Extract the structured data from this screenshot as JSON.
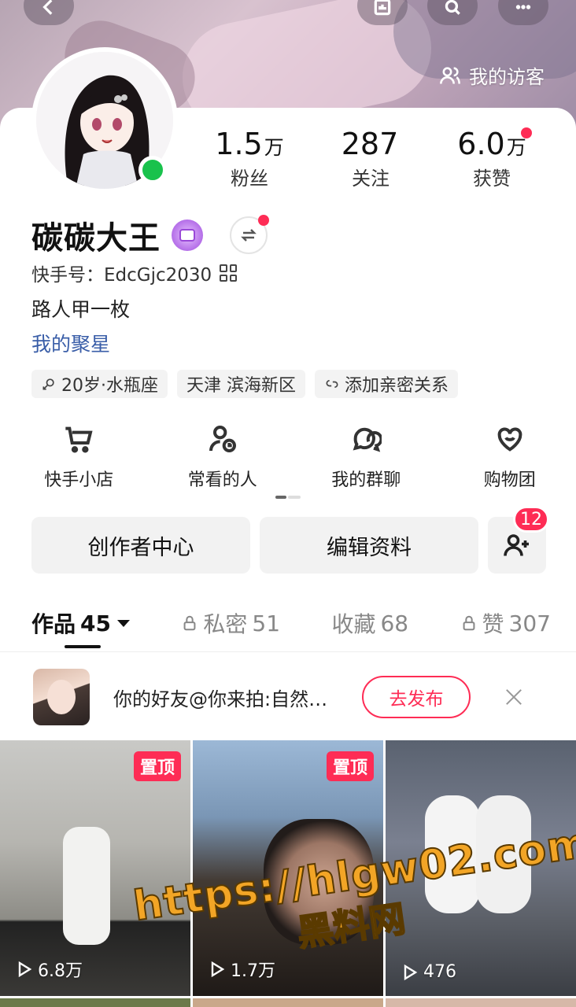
{
  "header": {
    "visitors_label": "我的访客"
  },
  "profile": {
    "stats": [
      {
        "num": "1.5",
        "unit": "万",
        "label": "粉丝"
      },
      {
        "num": "287",
        "unit": "",
        "label": "关注"
      },
      {
        "num": "6.0",
        "unit": "万",
        "label": "获赞"
      }
    ],
    "name": "碳碳大王",
    "kuaishou_id": "快手号：EdcGjc2030",
    "bio": "路人甲一枚",
    "fan_star": "我的聚星",
    "tags": [
      "20岁·水瓶座",
      "天津 滨海新区",
      "添加亲密关系"
    ]
  },
  "shortcuts": [
    {
      "label": "快手小店",
      "icon": "cart-icon"
    },
    {
      "label": "常看的人",
      "icon": "person-clock-icon"
    },
    {
      "label": "我的群聊",
      "icon": "group-chat-icon"
    },
    {
      "label": "购物团",
      "icon": "heart-bag-icon"
    }
  ],
  "actions": {
    "creator_center": "创作者中心",
    "edit_profile": "编辑资料",
    "add_friend_badge": "12"
  },
  "tabs": [
    {
      "label": "作品",
      "count": "45",
      "locked": false
    },
    {
      "label": "私密",
      "count": "51",
      "locked": true
    },
    {
      "label": "收藏",
      "count": "68",
      "locked": false
    },
    {
      "label": "赞",
      "count": "307",
      "locked": true
    }
  ],
  "notice": {
    "text": "你的好友@你来拍:自然…",
    "button": "去发布"
  },
  "videos": [
    {
      "pinned": true,
      "pin_label": "置顶",
      "plays": "6.8万"
    },
    {
      "pinned": true,
      "pin_label": "置顶",
      "plays": "1.7万"
    },
    {
      "pinned": false,
      "pin_label": "",
      "plays": "476"
    }
  ],
  "watermark": {
    "url": "https://hlgw02.com",
    "text": "黑料网"
  },
  "colors": {
    "accent": "#fe2c55",
    "online": "#19c24c",
    "link": "#3a5ea8"
  }
}
